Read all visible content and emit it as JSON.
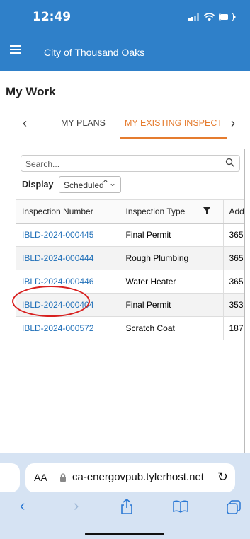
{
  "status_bar": {
    "time": "12:49"
  },
  "app_bar": {
    "title": "City of Thousand Oaks"
  },
  "page": {
    "title": "My Work"
  },
  "tabs": {
    "items": [
      {
        "label": "MY PLANS"
      },
      {
        "label": "MY EXISTING INSPECT"
      }
    ],
    "active": 1
  },
  "search": {
    "placeholder": "Search..."
  },
  "display": {
    "label": "Display",
    "selected": "Scheduled"
  },
  "table": {
    "headers": [
      "Inspection Number",
      "Inspection Type",
      "Add"
    ],
    "rows": [
      {
        "number": "IBLD-2024-000445",
        "type": "Final Permit",
        "addr": "365"
      },
      {
        "number": "IBLD-2024-000444",
        "type": "Rough Plumbing",
        "addr": "365"
      },
      {
        "number": "IBLD-2024-000446",
        "type": "Water Heater",
        "addr": "365"
      },
      {
        "number": "IBLD-2024-000404",
        "type": "Final Permit",
        "addr": "353"
      },
      {
        "number": "IBLD-2024-000572",
        "type": "Scratch Coat",
        "addr": "187"
      }
    ]
  },
  "browser": {
    "aa": "AA",
    "url": "ca-energovpub.tylerhost.net"
  },
  "colors": {
    "header": "#2f80c9",
    "accent": "#e57c2f",
    "link": "#1f6fb8",
    "highlight": "#d8201f"
  }
}
